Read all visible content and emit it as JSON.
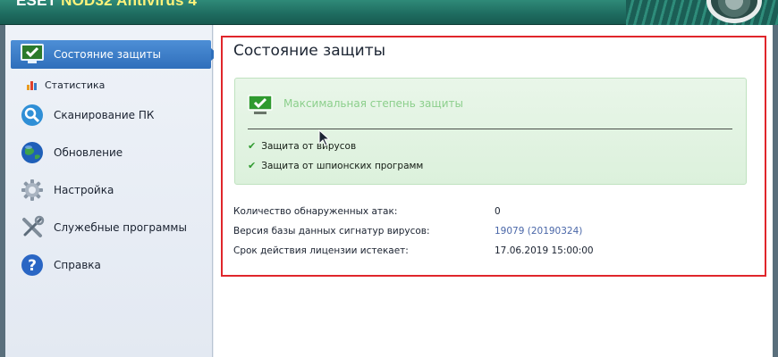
{
  "window": {
    "title_brand": "ESET",
    "title_product": "NOD32 Antivirus 4"
  },
  "sidebar": {
    "items": [
      {
        "label": "Состояние защиты",
        "icon": "monitor-check-icon",
        "active": true
      },
      {
        "label": "Сканирование ПК",
        "icon": "magnifier-icon"
      },
      {
        "label": "Обновление",
        "icon": "globe-icon"
      },
      {
        "label": "Настройка",
        "icon": "gear-icon"
      },
      {
        "label": "Служебные программы",
        "icon": "tools-icon"
      },
      {
        "label": "Справка",
        "icon": "help-icon"
      }
    ],
    "sub_item": {
      "label": "Статистика",
      "icon": "bar-chart-icon"
    }
  },
  "main": {
    "title": "Состояние защиты",
    "status": {
      "headline": "Максимальная степень защиты",
      "checks": [
        "Защита от вирусов",
        "Защита от шпионских программ"
      ]
    },
    "info": [
      {
        "label": "Количество обнаруженных атак:",
        "value": "0"
      },
      {
        "label": "Версия базы данных сигнатур вирусов:",
        "value": "19079 (20190324)"
      },
      {
        "label": "Срок действия лицензии истекает:",
        "value": "17.06.2019 15:00:00"
      }
    ]
  },
  "colors": {
    "titlebar": "#1f6d61",
    "sidebar_active": "#3a7fc8",
    "status_panel": "#e1f3e1",
    "highlight_border": "#e0262b",
    "link": "#4a67a8"
  }
}
